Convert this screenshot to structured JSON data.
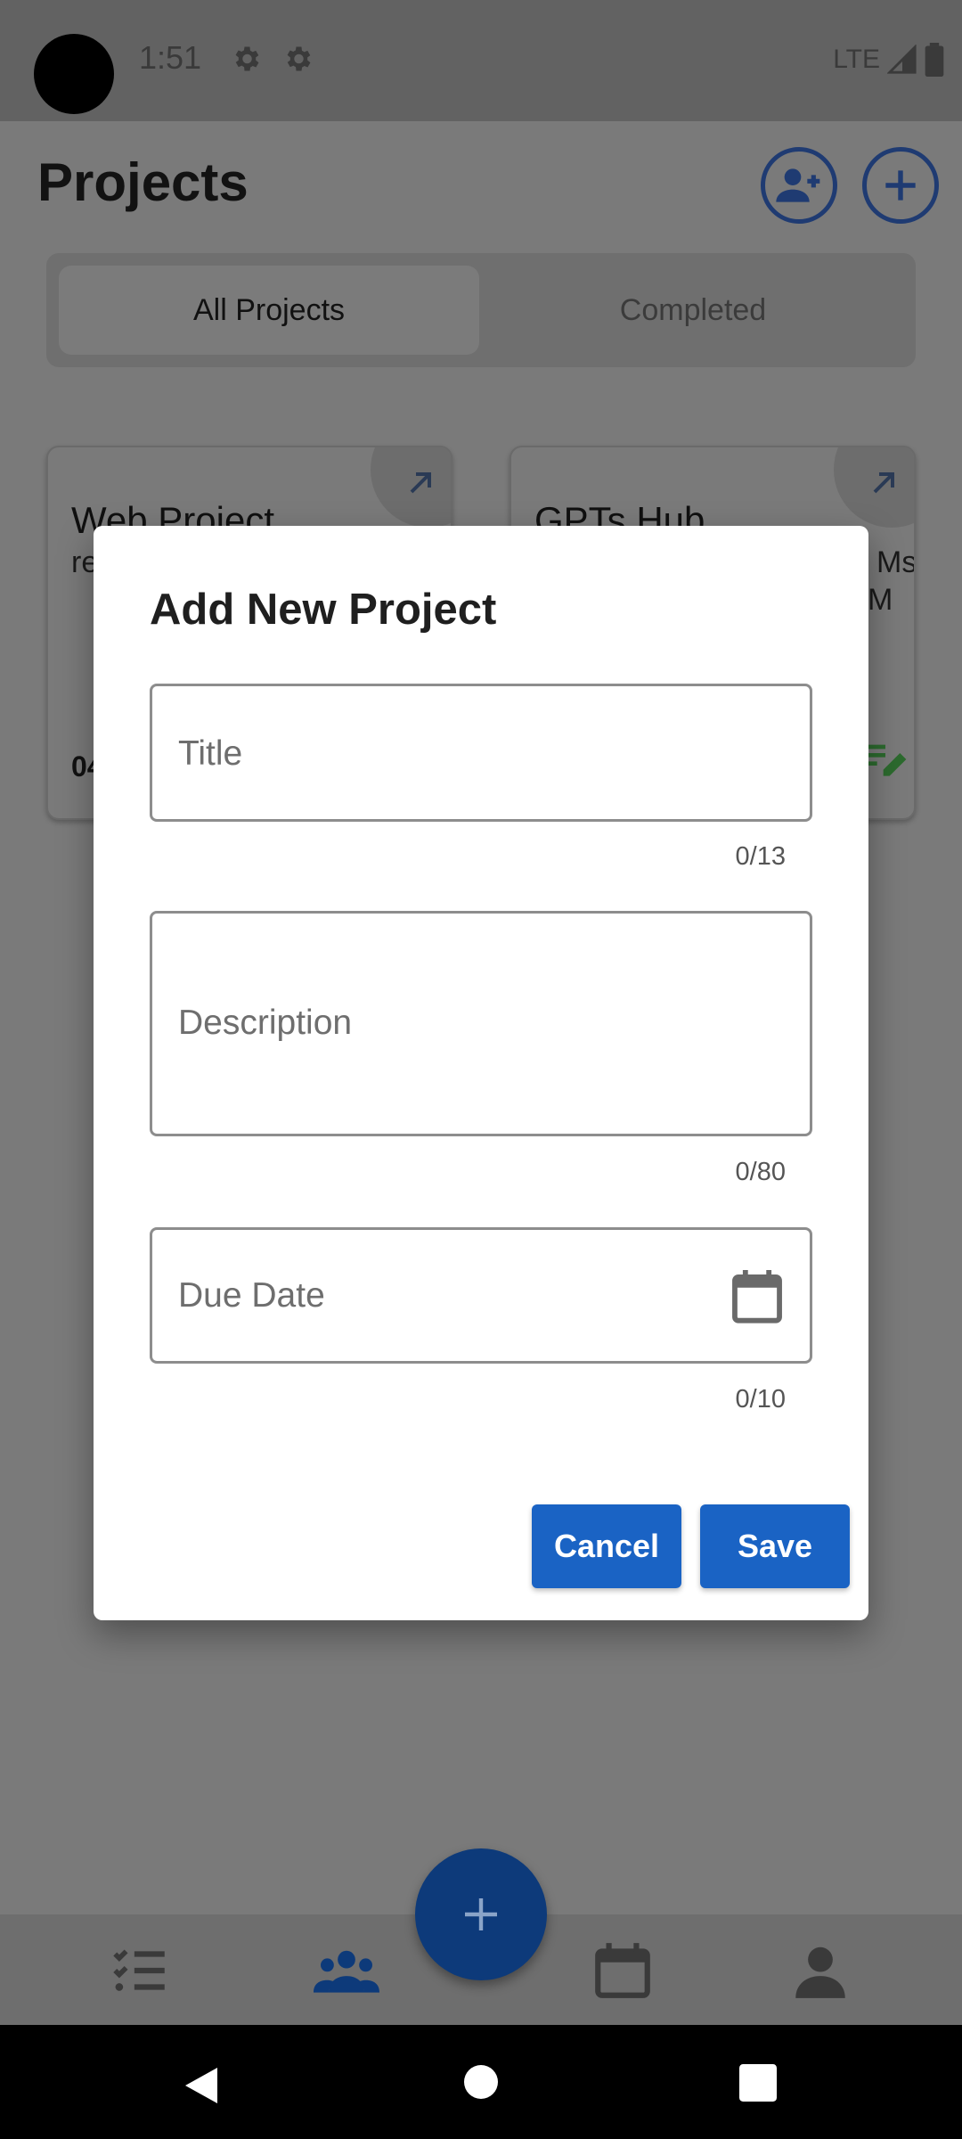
{
  "status_bar": {
    "time": "1:51",
    "network": "LTE"
  },
  "header": {
    "title": "Projects"
  },
  "tabs": [
    {
      "label": "All Projects"
    },
    {
      "label": "Completed"
    }
  ],
  "cards": [
    {
      "title": "Web Project",
      "subtitle": "re",
      "date": "04"
    },
    {
      "title": "GPTs Hub",
      "subtitle": "Ms",
      "subtitle2": "M"
    }
  ],
  "dialog": {
    "title": "Add New Project",
    "fields": {
      "title": {
        "placeholder": "Title",
        "counter": "0/13"
      },
      "description": {
        "placeholder": "Description",
        "counter": "0/80"
      },
      "due_date": {
        "placeholder": "Due Date",
        "counter": "0/10"
      }
    },
    "buttons": {
      "cancel": "Cancel",
      "save": "Save"
    }
  },
  "colors": {
    "accent": "#1a63c4",
    "dialog_bg": "#ffffff",
    "scrim": "#7a7a7a"
  },
  "icons": {
    "header": [
      "add-person-icon",
      "add-circle-icon"
    ],
    "nav": [
      "task-list-icon",
      "team-icon",
      "calendar-icon",
      "profile-icon"
    ],
    "fab": "plus-icon"
  }
}
